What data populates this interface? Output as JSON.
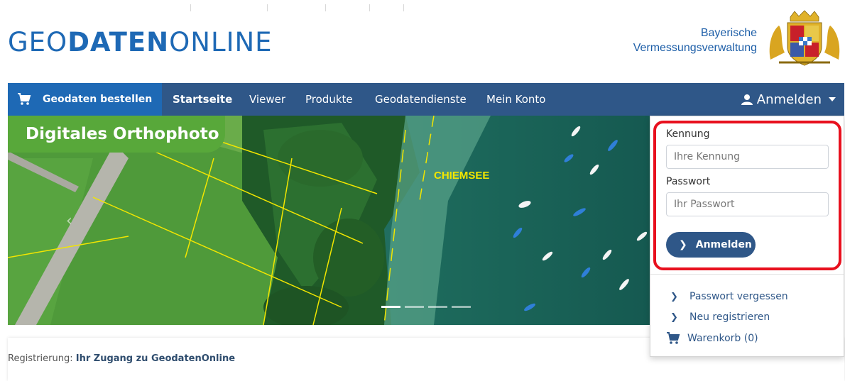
{
  "header": {
    "logo_part1": "GEO",
    "logo_part2": "DATEN",
    "logo_part3": "ONLINE",
    "agency_line1": "Bayerische",
    "agency_line2": "Vermessungsverwaltung"
  },
  "nav": {
    "order_label": "Geodaten bestellen",
    "items": [
      {
        "label": "Startseite"
      },
      {
        "label": "Viewer"
      },
      {
        "label": "Produkte"
      },
      {
        "label": "Geodatendienste"
      },
      {
        "label": "Mein Konto"
      }
    ],
    "login_label": "Anmelden"
  },
  "hero": {
    "badge": "Digitales Orthophoto",
    "lake_label": "CHIEMSEE",
    "prev_arrow": "‹",
    "slide_active": 1,
    "slide_count": 4
  },
  "login_dropdown": {
    "user_label": "Kennung",
    "user_placeholder": "Ihre Kennung",
    "password_label": "Passwort",
    "password_placeholder": "Ihr Passwort",
    "submit_label": "Anmelden",
    "links": {
      "forgot": "Passwort vergessen",
      "register": "Neu registrieren",
      "cart": "Warenkorb (0)"
    }
  },
  "registration": {
    "prefix": "Registrierung: ",
    "text": "Ihr Zugang zu GeodatenOnline"
  },
  "colors": {
    "brand_blue": "#1e69b5",
    "nav_bg": "#2f5788",
    "badge_green": "#58a83a",
    "highlight_red": "#e8101e"
  }
}
